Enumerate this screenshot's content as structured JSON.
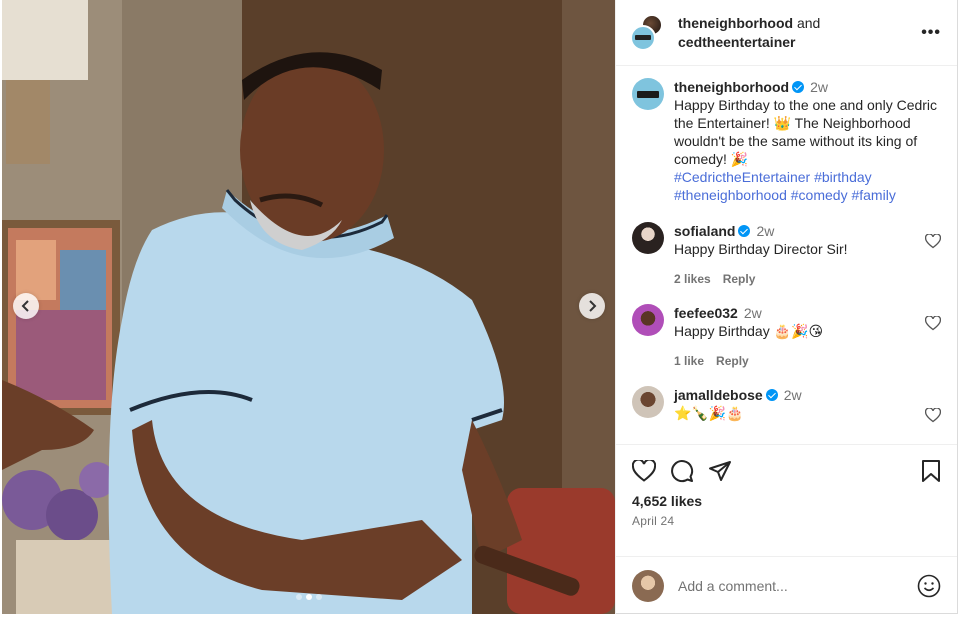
{
  "header": {
    "user1": "theneighborhood",
    "joiner": "and",
    "user2": "cedtheentertainer",
    "more": "•••"
  },
  "caption": {
    "username": "theneighborhood",
    "time": "2w",
    "text": "Happy Birthday to the one and only Cedric the Entertainer! 👑 The Neighborhood wouldn't be the same without its king of comedy! 🎉",
    "hashtags": "#CedrictheEntertainer #birthday #theneighborhood #comedy #family"
  },
  "comments": [
    {
      "username": "sofialand",
      "verified": true,
      "time": "2w",
      "text": "Happy Birthday Director Sir!",
      "likes": "2 likes",
      "reply": "Reply"
    },
    {
      "username": "feefee032",
      "verified": false,
      "time": "2w",
      "text": "Happy Birthday 🎂🎉😘",
      "likes": "1 like",
      "reply": "Reply"
    },
    {
      "username": "jamalldebose",
      "verified": true,
      "time": "2w",
      "text": "⭐🍾🎉🎂",
      "likes": "",
      "reply": ""
    }
  ],
  "stats": {
    "likes": "4,652 likes",
    "date": "April 24"
  },
  "composer": {
    "placeholder": "Add a comment..."
  },
  "carousel": {
    "slide_count": 3,
    "active_slide": 2
  },
  "icons": {
    "like": "heart-icon",
    "comment": "comment-icon",
    "share": "share-icon",
    "save": "bookmark-icon",
    "emoji": "emoji-icon",
    "prev": "chevron-left-icon",
    "next": "chevron-right-icon"
  },
  "colors": {
    "verified": "#0095f6",
    "hashtag": "#4a6dd8",
    "muted": "#737373"
  }
}
